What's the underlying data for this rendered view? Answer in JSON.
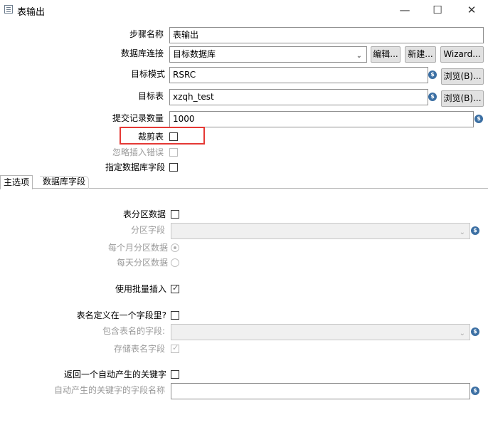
{
  "window": {
    "title": "表输出",
    "minimize": "—",
    "maximize": "☐",
    "close": "✕"
  },
  "form": {
    "step_name_label": "步骤名称",
    "step_name_value": "表输出",
    "connection_label": "数据库连接",
    "connection_value": "目标数据库",
    "edit_button": "编辑...",
    "new_button": "新建...",
    "wizard_button": "Wizard...",
    "schema_label": "目标模式",
    "schema_value": "RSRC",
    "browse1_button": "浏览(B)...",
    "table_label": "目标表",
    "table_value": "xzqh_test",
    "browse2_button": "浏览(B)...",
    "commit_label": "提交记录数量",
    "commit_value": "1000",
    "truncate_label": "裁剪表",
    "ignore_errors_label": "忽略插入错误",
    "specify_fields_label": "指定数据库字段"
  },
  "tabs": [
    {
      "label": "主选项"
    },
    {
      "label": "数据库字段"
    }
  ],
  "main": {
    "partition_label": "表分区数据",
    "partition_field_label": "分区字段",
    "monthly_label": "每个月分区数据",
    "daily_label": "每天分区数据",
    "batch_insert_label": "使用批量插入",
    "batch_insert_checked": true,
    "table_in_field_label": "表名定义在一个字段里?",
    "table_name_field_label": "包含表名的字段:",
    "store_table_name_label": "存储表名字段",
    "store_table_name_checked": true,
    "return_key_label": "返回一个自动产生的关键字",
    "key_field_name_label": "自动产生的关键字的字段名称"
  },
  "icons": {
    "variable": "$",
    "check": "✓",
    "dropdown": "⌄"
  },
  "colors": {
    "highlight": "#e53935",
    "variable_icon": "#3b6fa3"
  }
}
